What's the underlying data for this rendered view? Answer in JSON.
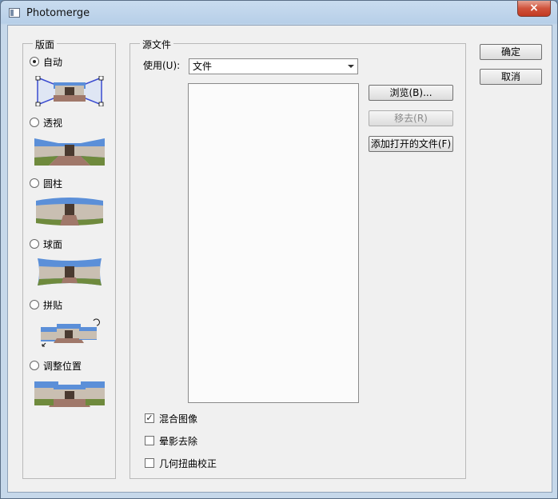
{
  "window": {
    "title": "Photomerge",
    "close_glyph": "×"
  },
  "layout_group": {
    "title": "版面",
    "options": [
      {
        "label": "自动",
        "selected": true,
        "thumb_icon": "panorama-auto-icon"
      },
      {
        "label": "透视",
        "selected": false,
        "thumb_icon": "panorama-perspective-icon"
      },
      {
        "label": "圆柱",
        "selected": false,
        "thumb_icon": "panorama-cylindrical-icon"
      },
      {
        "label": "球面",
        "selected": false,
        "thumb_icon": "panorama-spherical-icon"
      },
      {
        "label": "拼贴",
        "selected": false,
        "thumb_icon": "panorama-collage-icon"
      },
      {
        "label": "调整位置",
        "selected": false,
        "thumb_icon": "panorama-reposition-icon"
      }
    ]
  },
  "source_group": {
    "title": "源文件",
    "use_label": "使用(U):",
    "use_value": "文件",
    "buttons": {
      "browse": "浏览(B)...",
      "remove": "移去(R)",
      "add_open": "添加打开的文件(F)"
    }
  },
  "options": {
    "blend": {
      "label": "混合图像",
      "checked": true
    },
    "vignette": {
      "label": "晕影去除",
      "checked": false
    },
    "distortion": {
      "label": "几何扭曲校正",
      "checked": false
    }
  },
  "dialog_buttons": {
    "ok": "确定",
    "cancel": "取消"
  },
  "colors": {
    "sky": "#5b8fd8",
    "ground": "#a0786a",
    "building": "#c9bfb2",
    "grass": "#6f8a3d",
    "handle": "#3a4bd0"
  }
}
